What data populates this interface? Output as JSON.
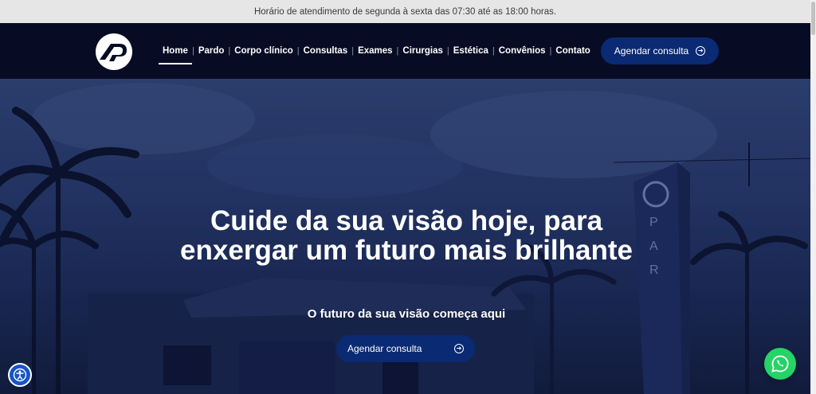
{
  "topbar": {
    "text": "Horário de atendimento de segunda à sexta das 07:30 até as 18:00 horas."
  },
  "nav": {
    "items": [
      {
        "label": "Home",
        "active": true
      },
      {
        "label": "Pardo"
      },
      {
        "label": "Corpo clínico"
      },
      {
        "label": "Consultas"
      },
      {
        "label": "Exames"
      },
      {
        "label": "Cirurgias"
      },
      {
        "label": "Estética"
      },
      {
        "label": "Convênios"
      },
      {
        "label": "Contato"
      }
    ],
    "cta_label": "Agendar consulta"
  },
  "hero": {
    "title": "Cuide da sua visão hoje, para enxergar um futuro mais brilhante",
    "subtitle": "O futuro da sua visão começa aqui",
    "cta_label": "Agendar consulta",
    "sign_letters": "PAR"
  },
  "colors": {
    "navbar_bg": "#070c24",
    "button_bg": "#0a2a73",
    "whatsapp": "#25d366",
    "accessibility": "#1456c4"
  },
  "icons": {
    "logo": "pardo-logo-icon",
    "accessibility": "accessibility-icon",
    "whatsapp": "whatsapp-icon",
    "arrow": "arrow-right-circle-icon"
  }
}
